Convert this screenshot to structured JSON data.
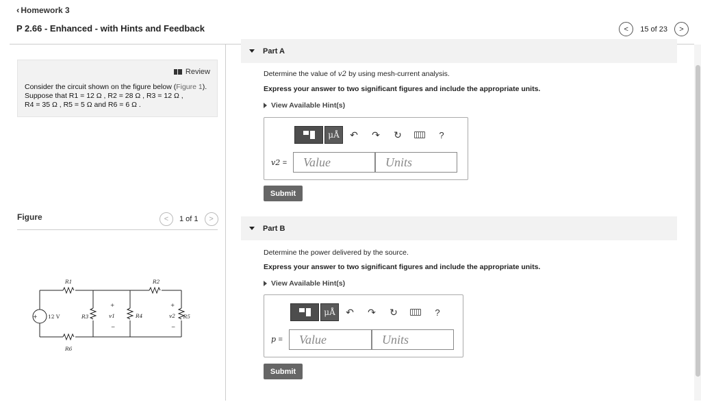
{
  "header": {
    "back_label": "Homework 3",
    "title": "P 2.66 - Enhanced - with Hints and Feedback",
    "pager_text": "15 of 23"
  },
  "problem": {
    "review_label": "Review",
    "line1_pre": "Consider the circuit shown on the figure below (",
    "line1_link": "Figure 1",
    "line1_post": ").",
    "line2": "Suppose that R1 = 12 Ω , R2 = 28 Ω , R3 = 12 Ω ,",
    "line3": "R4 = 35 Ω , R5 = 5 Ω and R6 = 6 Ω ."
  },
  "figure": {
    "label": "Figure",
    "pager_text": "1 of 1",
    "source_label": "12 V",
    "labels": [
      "R1",
      "R2",
      "R3",
      "R4",
      "R5",
      "R6",
      "v1",
      "v2"
    ]
  },
  "part_a": {
    "title": "Part A",
    "question_pre": "Determine the value of ",
    "question_var": "v2",
    "question_post": " by using mesh-current analysis.",
    "instruction": "Express your answer to two significant figures and include the appropriate units.",
    "hint_label": "View Available Hint(s)",
    "var_label": "v2",
    "eq": "=",
    "value_placeholder": "Value",
    "units_placeholder": "Units",
    "unit_button": "μÅ",
    "help": "?",
    "submit_label": "Submit"
  },
  "part_b": {
    "title": "Part B",
    "question": "Determine the power delivered by the source.",
    "instruction": "Express your answer to two significant figures and include the appropriate units.",
    "hint_label": "View Available Hint(s)",
    "var_label": "p",
    "eq": "=",
    "value_placeholder": "Value",
    "units_placeholder": "Units",
    "unit_button": "μÅ",
    "help": "?",
    "submit_label": "Submit"
  }
}
